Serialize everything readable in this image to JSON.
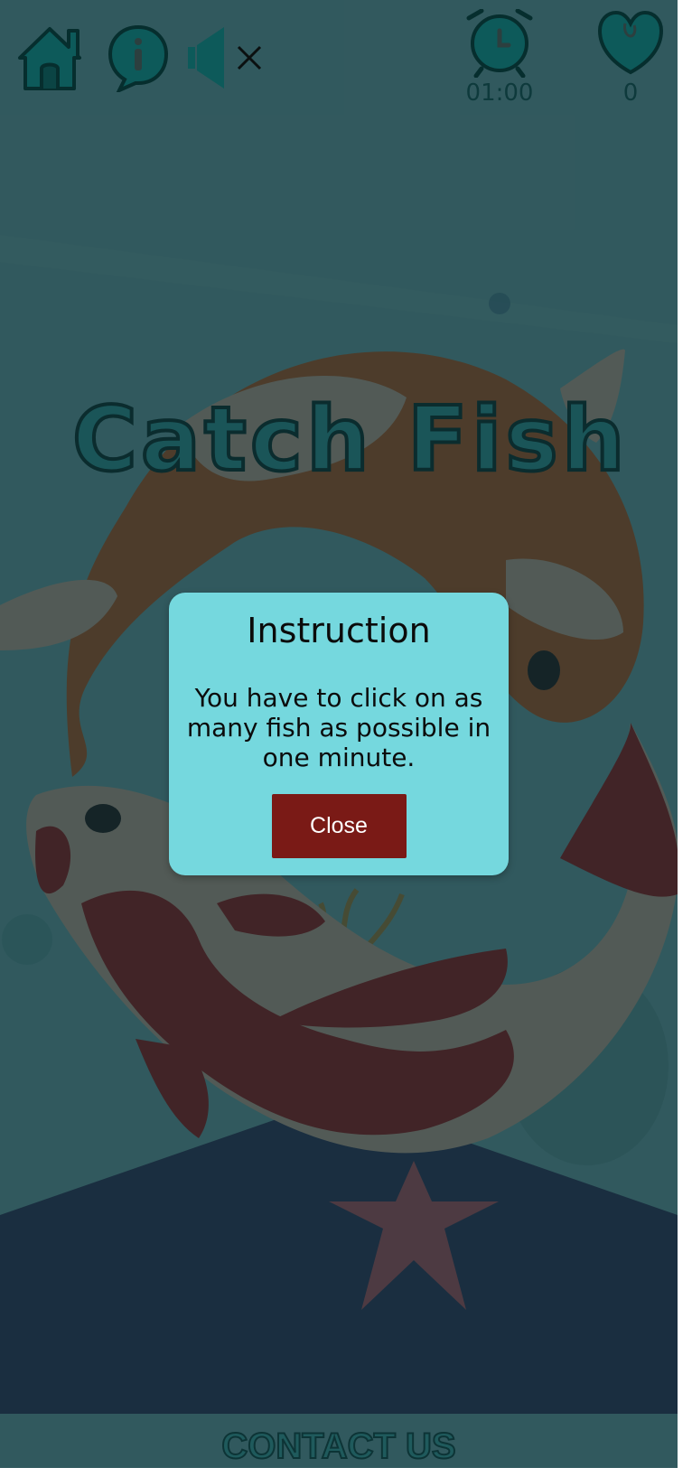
{
  "header": {
    "home_icon": "home-icon",
    "info_icon": "info-icon",
    "sound_icon": "sound-muted-icon",
    "timer_icon": "alarm-clock-icon",
    "timer_value": "01:00",
    "score_icon": "heart-icon",
    "score_value": "0"
  },
  "game": {
    "title": "Catch Fish"
  },
  "modal": {
    "title": "Instruction",
    "text": "You have to click on as many fish as possible in one minute.",
    "close_label": "Close"
  },
  "footer": {
    "contact_label": "CONTACT US"
  },
  "colors": {
    "water": "#7fd8dd",
    "sand": "#2c3f73",
    "modal_bg": "#75d8de",
    "close_button": "#7a1a16",
    "orange_fish": "#e0702a",
    "red_fish": "#b71c1c",
    "fish_cream": "#f5dcc0"
  }
}
